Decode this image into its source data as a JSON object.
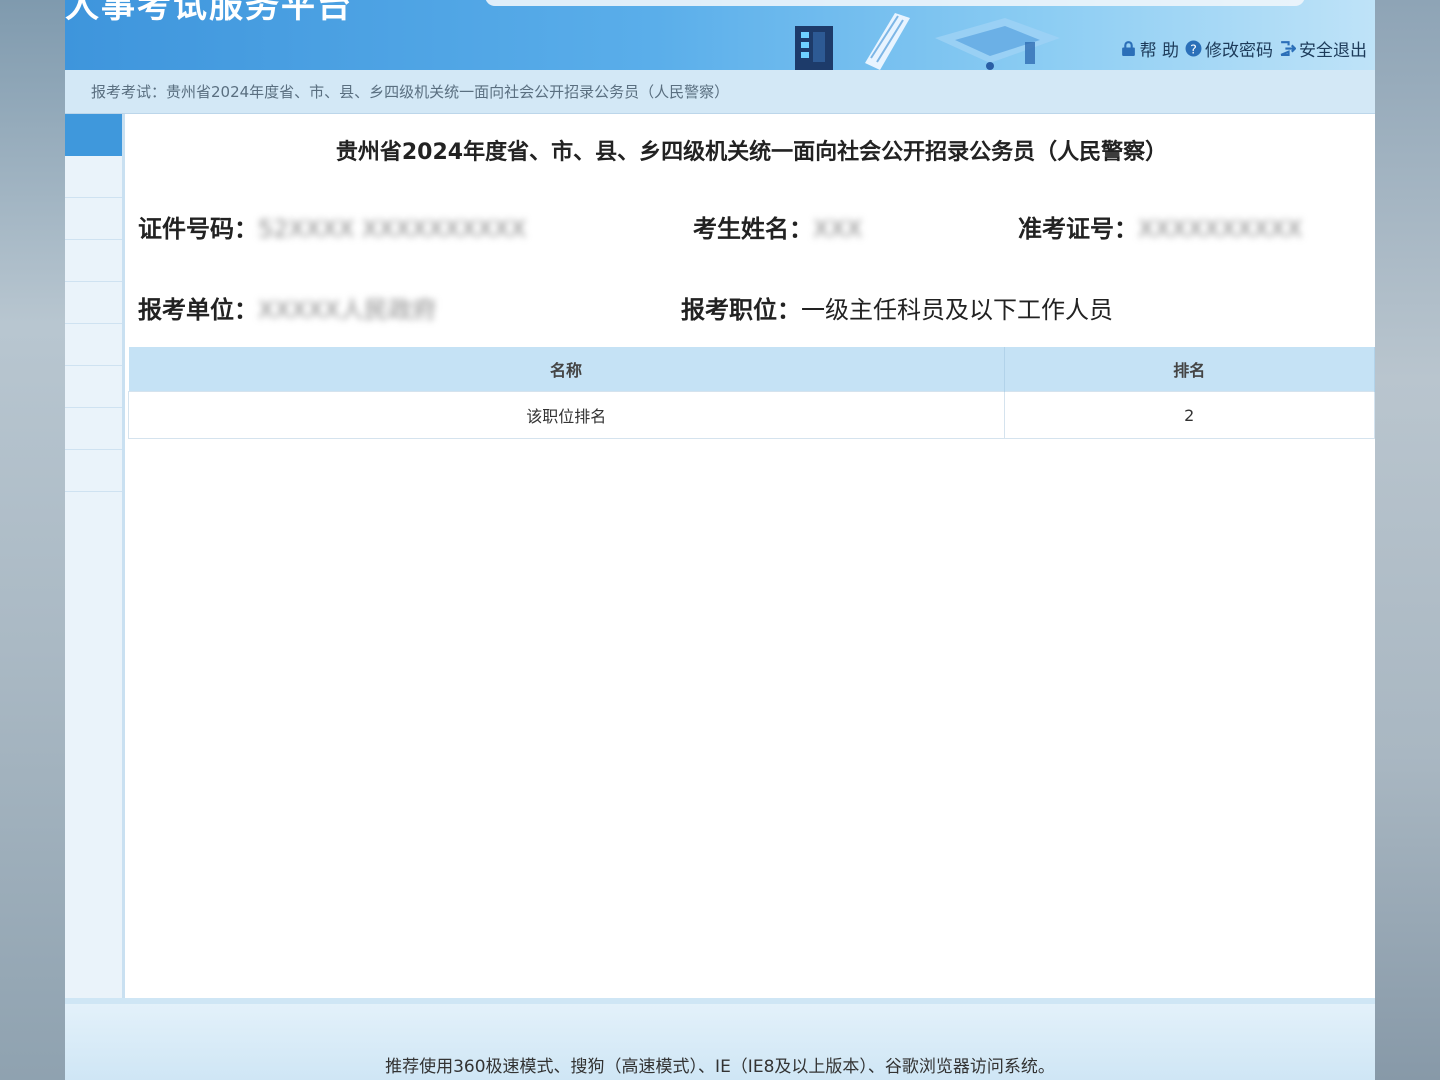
{
  "header": {
    "site_title": "人事考试服务平台",
    "links": [
      {
        "label": "帮 助",
        "icon": "lock-icon"
      },
      {
        "label": "修改密码",
        "icon": "question-icon"
      },
      {
        "label": "安全退出",
        "icon": "logout-icon"
      }
    ]
  },
  "breadcrumb": "报考考试：贵州省2024年度省、市、县、乡四级机关统一面向社会公开招录公务员（人民警察）",
  "main": {
    "exam_title": "贵州省2024年度省、市、县、乡四级机关统一面向社会公开招录公务员（人民警察）",
    "id_label": "证件号码：",
    "id_value": "52XXXX XXXXXXXXXX",
    "name_label": "考生姓名：",
    "name_value": "XXX",
    "ticket_label": "准考证号：",
    "ticket_value": "XXXXXXXXXX",
    "unit_label": "报考单位：",
    "unit_value": "XXXXX人民政府",
    "position_label": "报考职位：",
    "position_value": "一级主任科员及以下工作人员"
  },
  "table": {
    "headers": [
      "名称",
      "排名"
    ],
    "rows": [
      {
        "name": "该职位排名",
        "rank": "2"
      }
    ]
  },
  "footer": {
    "note": "推荐使用360极速模式、搜狗（高速模式）、IE（IE8及以上版本）、谷歌浏览器访问系统。"
  },
  "colors": {
    "accent": "#3f98dc",
    "table_header": "#c5e2f5",
    "breadcrumb_bg": "#d3e8f6"
  }
}
